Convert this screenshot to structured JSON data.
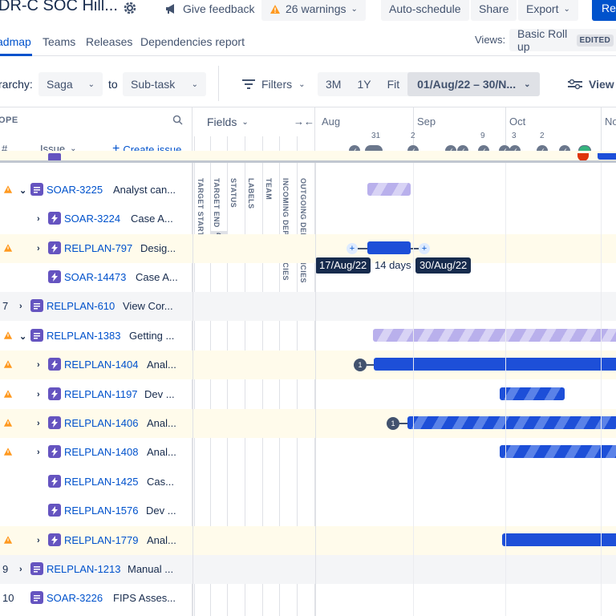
{
  "header": {
    "plan_title": "DR-C SOC Hill...",
    "feedback_label": "Give feedback",
    "warnings_label": "26 warnings",
    "autoschedule_label": "Auto-schedule",
    "share_label": "Share",
    "export_label": "Export",
    "review_label": "Rev"
  },
  "tabs": {
    "items": [
      "adAmap",
      "Teams",
      "Releases",
      "Dependencies report"
    ],
    "views_label": "Views:",
    "view_name": "Basic Roll up",
    "edited_badge": "EDITED"
  },
  "controls": {
    "hierarchy_label": "rarchy:",
    "from_value": "Saga",
    "to_label": "to",
    "to_value": "Sub-task",
    "filters_label": "Filters",
    "range_3m": "3M",
    "range_1y": "1Y",
    "range_fit": "Fit",
    "date_range": "01/Aug/22 – 30/N...",
    "view_settings_label": "View s"
  },
  "grid": {
    "scope_label": "OPE",
    "hash_label": "#",
    "issue_label": "Issue",
    "create_issue_label": "Create issue",
    "fields_label": "Fields",
    "field_columns": [
      "TARGET START",
      "TARGET END",
      "STATUS",
      "LABELS",
      "TEAM",
      "INCOMING DEPENDENCIES",
      "OUTGOING DEPENDENCIES"
    ],
    "field_tag_start": "D",
    "field_tag_end": "D"
  },
  "timeline": {
    "months": [
      "Aug",
      "Sep",
      "Oct",
      "No"
    ],
    "milestone_numbers": [
      "31",
      "2",
      "9",
      "3",
      "2"
    ],
    "date_start": "17/Aug/22",
    "duration": "14 days",
    "date_end": "30/Aug/22",
    "dep_badge_1": "1",
    "dep_badge_2": "1"
  },
  "rows": [
    {
      "rank": "",
      "key": "SOAR-3225",
      "title": "Analyst can...",
      "warning": true,
      "chevron": "v"
    },
    {
      "rank": "",
      "key": "SOAR-3224",
      "title": "Case A...",
      "warning": false,
      "chevron": ">"
    },
    {
      "rank": "",
      "key": "RELPLAN-797",
      "title": "Desig...",
      "warning": true,
      "chevron": ">"
    },
    {
      "rank": "",
      "key": "SOAR-14473",
      "title": "Case A...",
      "warning": false,
      "chevron": ""
    },
    {
      "rank": "7",
      "key": "RELPLAN-610",
      "title": "View Cor...",
      "warning": false,
      "chevron": ">"
    },
    {
      "rank": "",
      "key": "RELPLAN-1383",
      "title": "Getting ...",
      "warning": true,
      "chevron": "v"
    },
    {
      "rank": "",
      "key": "RELPLAN-1404",
      "title": "Anal...",
      "warning": true,
      "chevron": ">"
    },
    {
      "rank": "",
      "key": "RELPLAN-1197",
      "title": "Dev ...",
      "warning": true,
      "chevron": ">"
    },
    {
      "rank": "",
      "key": "RELPLAN-1406",
      "title": "Anal...",
      "warning": true,
      "chevron": ">"
    },
    {
      "rank": "",
      "key": "RELPLAN-1408",
      "title": "Anal...",
      "warning": true,
      "chevron": ">"
    },
    {
      "rank": "",
      "key": "RELPLAN-1425",
      "title": "Cas...",
      "warning": false,
      "chevron": ""
    },
    {
      "rank": "",
      "key": "RELPLAN-1576",
      "title": "Dev ...",
      "warning": false,
      "chevron": ""
    },
    {
      "rank": "",
      "key": "RELPLAN-1779",
      "title": "Anal...",
      "warning": true,
      "chevron": ">"
    },
    {
      "rank": "9",
      "key": "RELPLAN-1213",
      "title": "Manual ...",
      "warning": false,
      "chevron": ">"
    },
    {
      "rank": "10",
      "key": "SOAR-3226",
      "title": "FIPS Asses...",
      "warning": false,
      "chevron": ""
    }
  ]
}
